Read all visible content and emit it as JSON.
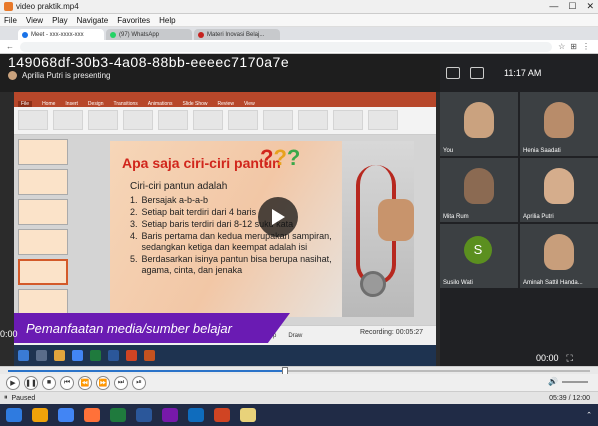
{
  "window": {
    "title": "video praktik.mp4",
    "controls": [
      "—",
      "☐",
      "✕"
    ]
  },
  "menu": [
    "File",
    "View",
    "Play",
    "Navigate",
    "Favorites",
    "Help"
  ],
  "browser": {
    "tabs": [
      {
        "label": "Meet - xxx-xxxx-xxx",
        "color": "#1a73e8",
        "active": true
      },
      {
        "label": "(97) WhatsApp",
        "color": "#25d366",
        "active": false
      },
      {
        "label": "Materi Inovasi Belaj...",
        "color": "#c5221f",
        "active": false
      }
    ]
  },
  "meet": {
    "meeting_id": "149068df-30b3-4a08-88bb-eeeec7170a7e",
    "presenting": "Aprilia Putri is presenting",
    "clock": "11:17 AM",
    "participants": [
      {
        "name": "You",
        "face": "#caa27f"
      },
      {
        "name": "Henia Saadati",
        "face": "#b88c6a"
      },
      {
        "name": "Mita Rum",
        "face": "#8b6a52"
      },
      {
        "name": "Aprilia Putri",
        "face": "#d5ad8c"
      },
      {
        "name": "Susilo Wati",
        "initial": "S"
      },
      {
        "name": "Aminah Sattil Handa...",
        "face": "#c89e7b"
      }
    ]
  },
  "slide": {
    "title": "Apa saja ciri-ciri pantun",
    "subtitle": "Ciri-ciri pantun adalah",
    "items": [
      {
        "n": "1.",
        "text": "Bersajak a-b-a-b"
      },
      {
        "n": "2.",
        "text": "Setiap bait terdiri dari 4 baris"
      },
      {
        "n": "3.",
        "text": "Setiap baris terdiri dari 8-12 suku kata"
      },
      {
        "n": "4.",
        "text": "Baris pertama dan kedua merupakan sampiran, sedangkan ketiga dan keempat adalah isi"
      },
      {
        "n": "5.",
        "text": "Berdasarkan isinya pantun bisa berupa nasihat, agama, cinta, dan jenaka"
      }
    ]
  },
  "ppt": {
    "tabs": [
      "File",
      "Home",
      "Insert",
      "Design",
      "Transitions",
      "Animations",
      "Slide Show",
      "Review",
      "View"
    ],
    "recording": "Recording: 00:05:27",
    "stop_label": "Stop",
    "draw_label": "Draw"
  },
  "caption": "Pemanfaatan media/sumber belajar",
  "video_time": {
    "left": "0:00",
    "right": "00:00"
  },
  "player": {
    "status": "Paused",
    "time": "05:39 / 12:00"
  },
  "colors": {
    "caption": "#6a1bb3",
    "accent": "#2a73c9"
  }
}
